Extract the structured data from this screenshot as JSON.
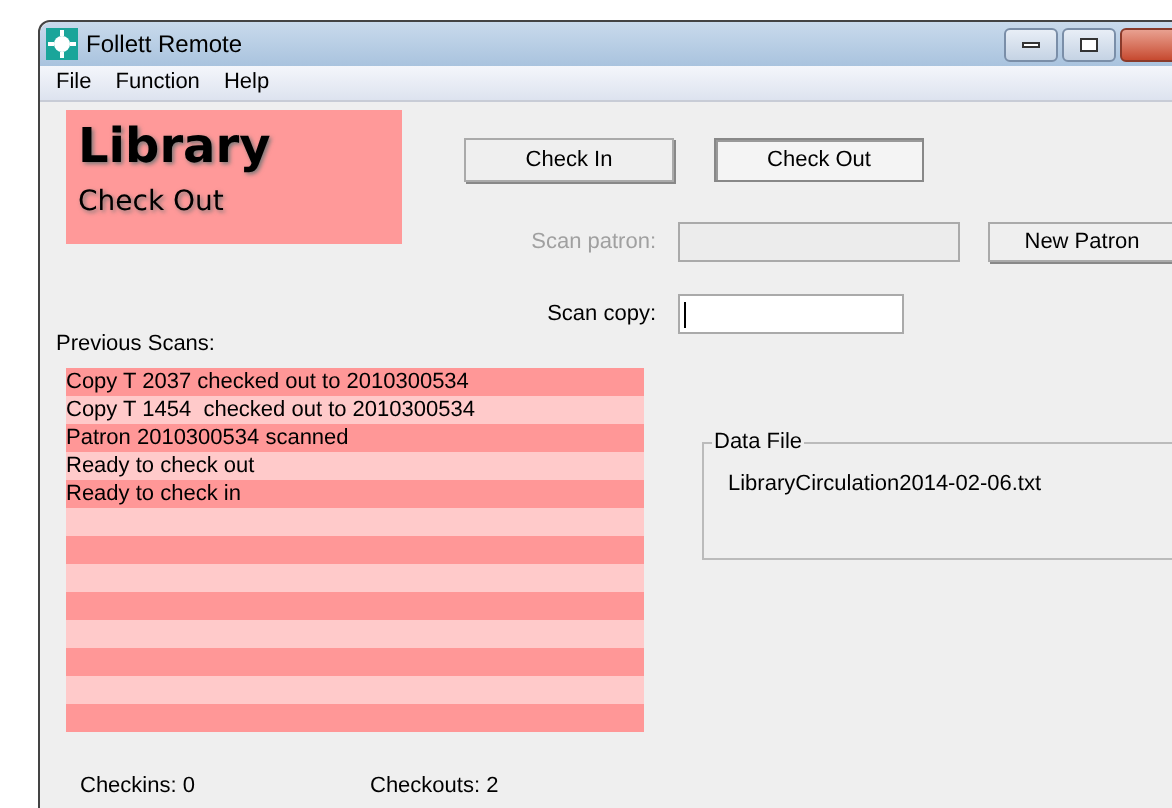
{
  "window": {
    "title": "Follett Remote"
  },
  "menu": [
    "File",
    "Function",
    "Help"
  ],
  "banner": {
    "title": "Library",
    "mode": "Check Out"
  },
  "mode_buttons": [
    {
      "label": "Check In",
      "selected": false
    },
    {
      "label": "Check Out",
      "selected": true
    }
  ],
  "scan_patron": {
    "label": "Scan patron:",
    "disabled": true
  },
  "new_patron_button": "New Patron",
  "scan_copy": {
    "label": "Scan copy:",
    "disabled": false,
    "focused": true
  },
  "previous_scans": {
    "label": "Previous Scans:",
    "items": [
      "Copy T 2037 checked out to 2010300534",
      "Copy T 1454  checked out to 2010300534",
      "Patron 2010300534 scanned",
      "Ready to check out",
      "Ready to check in"
    ]
  },
  "data_file": {
    "label": "Data File",
    "value": "LibraryCirculation2014-02-06.txt"
  },
  "status": {
    "checkins": "Checkins: 0",
    "checkouts": "Checkouts: 2"
  }
}
